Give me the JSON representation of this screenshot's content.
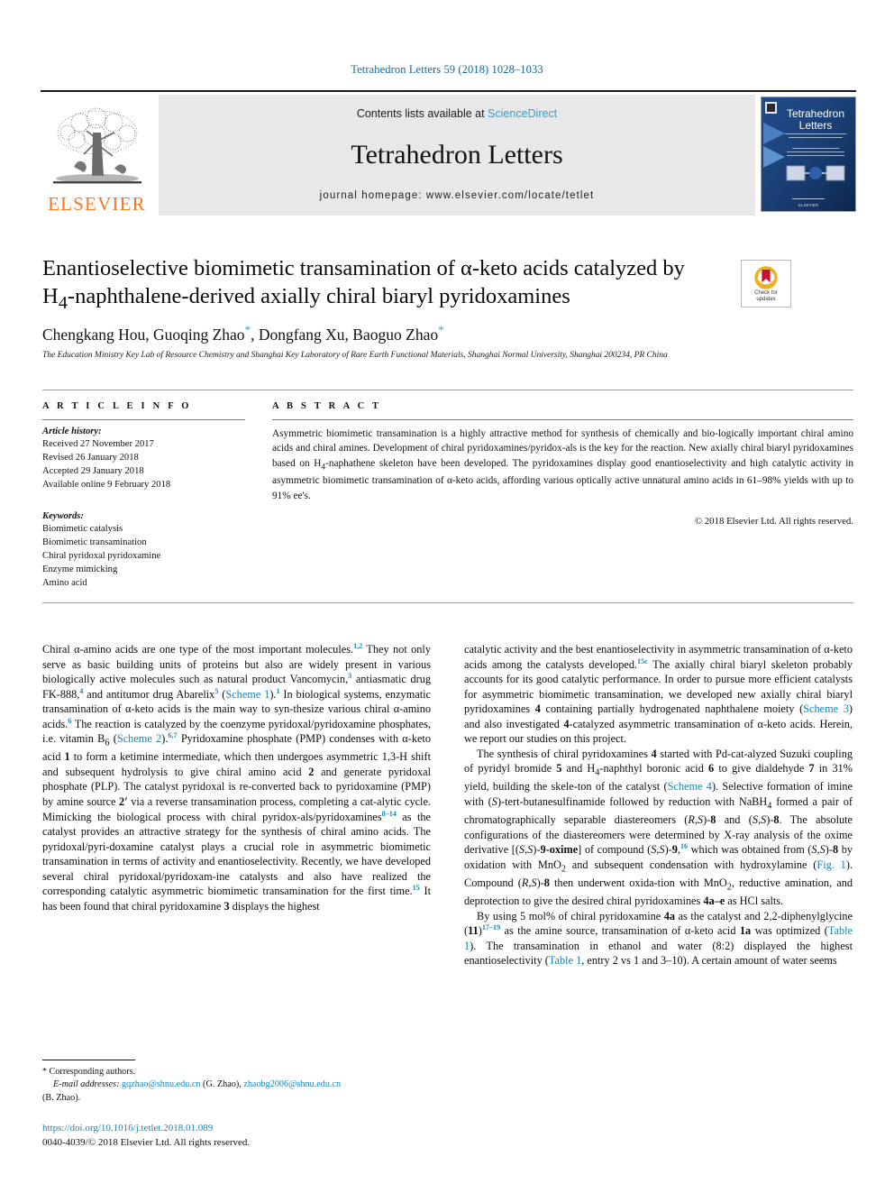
{
  "running_head": "Tetrahedron Letters 59 (2018) 1028–1033",
  "masthead": {
    "publisher": "ELSEVIER",
    "contents_prefix": "Contents lists available at ",
    "sciencedirect": "ScienceDirect",
    "journal_title": "Tetrahedron Letters",
    "homepage": "journal homepage: www.elsevier.com/locate/tetlet",
    "cover_title_line1": "Tetrahedron",
    "cover_title_line2": "Letters"
  },
  "crossmark": {
    "line1": "Check for",
    "line2": "updates"
  },
  "article": {
    "title_line1": "Enantioselective biomimetic transamination of α-keto acids catalyzed by",
    "title_line2_pre": "H",
    "title_line2_sub": "4",
    "title_line2_post": "-naphthalene-derived axially chiral biaryl pyridoxamines",
    "authors": "Chengkang Hou, Guoqing Zhao , Dongfang Xu, Baoguo Zhao",
    "authors_a": "Chengkang Hou, Guoqing Zhao",
    "authors_b": ", Dongfang Xu, Baoguo Zhao",
    "star": "*",
    "affiliation": "The Education Ministry Key Lab of Resource Chemistry and Shanghai Key Laboratory of Rare Earth Functional Materials, Shanghai Normal University, Shanghai 200234, PR China"
  },
  "article_info": {
    "heading": "A R T I C L E   I N F O",
    "history_label": "Article history:",
    "history": [
      "Received 27 November 2017",
      "Revised 26 January 2018",
      "Accepted 29 January 2018",
      "Available online 9 February 2018"
    ],
    "keywords_label": "Keywords:",
    "keywords": [
      "Biomimetic catalysis",
      "Biomimetic transamination",
      "Chiral pyridoxal pyridoxamine",
      "Enzyme mimicking",
      "Amino acid"
    ]
  },
  "abstract": {
    "heading": "A B S T R A C T",
    "text_p1": "Asymmetric biomimetic transamination is a highly attractive method for synthesis of chemically and bio-logically important chiral amino acids and chiral amines. Development of chiral pyridoxamines/pyridox-als is the key for the reaction. New axially chiral biaryl pyridoxamines based on H",
    "text_sub": "4",
    "text_p2": "-naphathene skeleton have been developed. The pyridoxamines display good enantioselectivity and high catalytic activity in asymmetric biomimetic transamination of α-keto acids, affording various optically active unnatural amino acids in 61–98% yields with up to 91% ee's.",
    "copyright": "© 2018 Elsevier Ltd. All rights reserved."
  },
  "body": {
    "left_p1_a": "Chiral α-amino acids are one type of the most important molecules.",
    "left_p1_ref1": "1,2",
    "left_p1_b": " They not only serve as basic building units of proteins but also are widely present in various biologically active molecules such as natural product Vancomycin,",
    "left_p1_ref2": "3",
    "left_p1_c": " antiasmatic drug FK-888,",
    "left_p1_ref3": "4",
    "left_p1_d": " and antitumor drug Abarelix",
    "left_p1_ref4": "5",
    "left_p1_e": " (",
    "left_p1_link1": "Scheme 1",
    "left_p1_f": ").",
    "left_p1_ref5": "1",
    "left_p1_g": " In biological systems, enzymatic transamination of α-keto acids is the main way to syn-thesize various chiral α-amino acids.",
    "left_p1_ref6": "6",
    "left_p1_h": " The reaction is catalyzed by the coenzyme pyridoxal/pyridoxamine phosphates, i.e. vitamin B",
    "left_p1_sub1": "6",
    "left_p1_i": " (",
    "left_p1_link2": "Scheme 2",
    "left_p1_j": ").",
    "left_p1_ref7": "6,7",
    "left_p1_k": " Pyridoxamine phosphate (PMP) condenses with α-keto acid ",
    "left_p1_b1": "1",
    "left_p1_l": " to form a ketimine intermediate, which then undergoes asymmetric 1,3-H shift and subsequent hydrolysis to give chiral amino acid ",
    "left_p1_b2": "2",
    "left_p1_m": " and generate pyridoxal phosphate (PLP). The catalyst pyridoxal is re-converted back to pyridoxamine (PMP) by amine source ",
    "left_p1_b3": "2′",
    "left_p1_n": " via a reverse transamination process, completing a cat-alytic cycle. Mimicking the biological process with chiral pyridox-als/pyridoxamines",
    "left_p1_ref8": "8–14",
    "left_p1_o": " as the catalyst provides an attractive strategy for the synthesis of chiral amino acids. The pyridoxal/pyri-doxamine catalyst plays a crucial role in asymmetric biomimetic transamination in terms of activity and enantioselectivity. Recently, we have developed several chiral pyridoxal/pyridoxam-ine catalysts and also have realized the corresponding catalytic asymmetric biomimetic transamination for the first time.",
    "left_p1_ref9": "15",
    "left_p1_p": " It has been found that chiral pyridoxamine ",
    "left_p1_b4": "3",
    "left_p1_q": " displays the highest",
    "right_p1_a": "catalytic activity and the best enantioselectivity in asymmetric transamination of α-keto acids among the catalysts developed.",
    "right_p1_ref1": "15c",
    "right_p1_b": " The axially chiral biaryl skeleton probably accounts for its good catalytic performance. In order to pursue more efficient catalysts for asymmetric biomimetic transamination, we developed new axially chiral biaryl pyridoxamines ",
    "right_p1_b1": "4",
    "right_p1_c": " containing partially hydrogenated naphthalene moiety (",
    "right_p1_link1": "Scheme 3",
    "right_p1_d": ") and also investigated ",
    "right_p1_b2": "4",
    "right_p1_e": "-catalyzed asymmetric transamination of α-keto acids. Herein, we report our studies on this project.",
    "right_p2_a": "The synthesis of chiral pyridoxamines ",
    "right_p2_b1": "4",
    "right_p2_b": " started with Pd-cat-alyzed Suzuki coupling of pyridyl bromide ",
    "right_p2_b2": "5",
    "right_p2_c": " and H",
    "right_p2_sub1": "4",
    "right_p2_d": "-naphthyl boronic acid ",
    "right_p2_b3": "6",
    "right_p2_e": " to give dialdehyde ",
    "right_p2_b4": "7",
    "right_p2_f": " in 31% yield, building the skele-ton of the catalyst (",
    "right_p2_link1": "Scheme 4",
    "right_p2_g": "). Selective formation of imine with (",
    "right_p2_i1": "S",
    "right_p2_h": ")-tert-butanesulfinamide followed by reduction with NaBH",
    "right_p2_sub2": "4",
    "right_p2_i": " formed a pair of chromatographically separable diastereomers (",
    "right_p2_i2": "R,S",
    "right_p2_j": ")-",
    "right_p2_b5": "8",
    "right_p2_k": " and (",
    "right_p2_i3": "S,S",
    "right_p2_l": ")-",
    "right_p2_b6": "8",
    "right_p2_m": ". The absolute configurations of the diastereomers were determined by X-ray analysis of the oxime derivative [(",
    "right_p2_i4": "S,S",
    "right_p2_n": ")-",
    "right_p2_b7": "9-oxime",
    "right_p2_o": "] of compound (",
    "right_p2_i5": "S,S",
    "right_p2_p": ")-",
    "right_p2_b8": "9",
    "right_p2_q": ",",
    "right_p2_ref1": "16",
    "right_p2_r": " which was obtained from (",
    "right_p2_i6": "S,S",
    "right_p2_s": ")-",
    "right_p2_b9": "8",
    "right_p2_t": " by oxidation with MnO",
    "right_p2_sub3": "2",
    "right_p2_u": " and subsequent condensation with hydroxylamine (",
    "right_p2_link2": "Fig. 1",
    "right_p2_v": "). Compound (",
    "right_p2_i7": "R,S",
    "right_p2_w": ")-",
    "right_p2_b10": "8",
    "right_p2_x": " then underwent oxida-tion with MnO",
    "right_p2_sub4": "2",
    "right_p2_y": ", reductive amination, and deprotection to give the desired chiral pyridoxamines ",
    "right_p2_b11": "4a–e",
    "right_p2_z": " as HCl salts.",
    "right_p3_a": "By using 5 mol% of chiral pyridoxamine ",
    "right_p3_b1": "4a",
    "right_p3_b": " as the catalyst and 2,2-diphenylglycine (",
    "right_p3_b2": "11",
    "right_p3_c": ")",
    "right_p3_ref1": "17–19",
    "right_p3_d": " as the amine source, transamination of α-keto acid ",
    "right_p3_b3": "1a",
    "right_p3_e": " was optimized (",
    "right_p3_link1": "Table 1",
    "right_p3_f": "). The transamination in ethanol and water (8:2) displayed the highest enantioselectivity (",
    "right_p3_link2": "Table 1",
    "right_p3_g": ", entry 2 vs 1 and 3–10). A certain amount of water seems"
  },
  "footnote": {
    "star": "*",
    "corresponding": " Corresponding authors.",
    "email_label": "E-mail addresses:",
    "email1": "gqzhao@shnu.edu.cn",
    "email1_who": " (G. Zhao),",
    "email2": "zhaobg2006@shnu.edu.cn",
    "email2_who": "(B. Zhao)."
  },
  "doi": {
    "url": "https://doi.org/10.1016/j.tetlet.2018.01.089",
    "issn_line": "0040-4039/© 2018 Elsevier Ltd. All rights reserved."
  },
  "colors": {
    "link_blue": "#1784b8",
    "header_blue": "#11689c",
    "elsevier_orange": "#f47920",
    "band_gray": "#e8e8e8"
  }
}
